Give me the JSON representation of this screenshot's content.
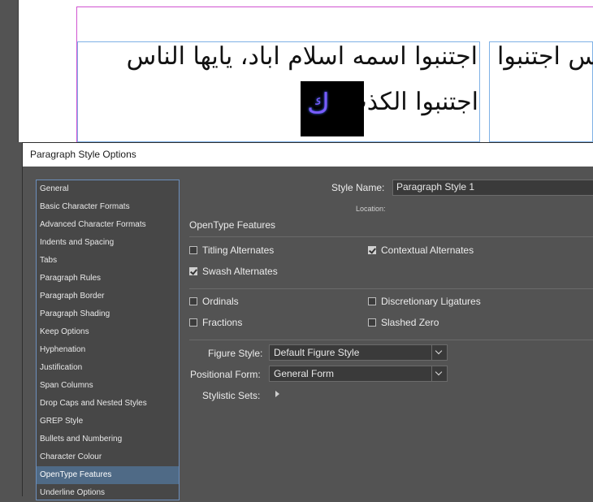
{
  "document": {
    "line1": "اجتنبوا اسمه اسلام اباد، يايها الناس",
    "line2": "اجتنبوا الكذب",
    "line3": "اس اجتنبوا",
    "selected_glyph": "ك"
  },
  "dialog": {
    "title": "Paragraph Style Options",
    "style_name_label": "Style Name:",
    "style_name_value": "Paragraph Style 1",
    "location_label": "Location:",
    "section_title": "OpenType Features",
    "sidebar": [
      "General",
      "Basic Character Formats",
      "Advanced Character Formats",
      "Indents and Spacing",
      "Tabs",
      "Paragraph Rules",
      "Paragraph Border",
      "Paragraph Shading",
      "Keep Options",
      "Hyphenation",
      "Justification",
      "Span Columns",
      "Drop Caps and Nested Styles",
      "GREP Style",
      "Bullets and Numbering",
      "Character Colour",
      "OpenType Features",
      "Underline Options"
    ],
    "active_item": "OpenType Features",
    "checkboxes": {
      "titling": {
        "label": "Titling Alternates",
        "checked": false
      },
      "contextual": {
        "label": "Contextual Alternates",
        "checked": true
      },
      "swash": {
        "label": "Swash Alternates",
        "checked": true
      },
      "ordinals": {
        "label": "Ordinals",
        "checked": false
      },
      "discretionary": {
        "label": "Discretionary Ligatures",
        "checked": false
      },
      "fractions": {
        "label": "Fractions",
        "checked": false
      },
      "slashed_zero": {
        "label": "Slashed Zero",
        "checked": false
      }
    },
    "figure_style_label": "Figure Style:",
    "figure_style_value": "Default Figure Style",
    "positional_form_label": "Positional Form:",
    "positional_form_value": "General Form",
    "stylistic_sets_label": "Stylistic Sets:"
  },
  "colors": {
    "selection_highlight": "#4f6a86",
    "margin_guide": "#d154d1",
    "frame_edge": "#7fb1e6"
  }
}
